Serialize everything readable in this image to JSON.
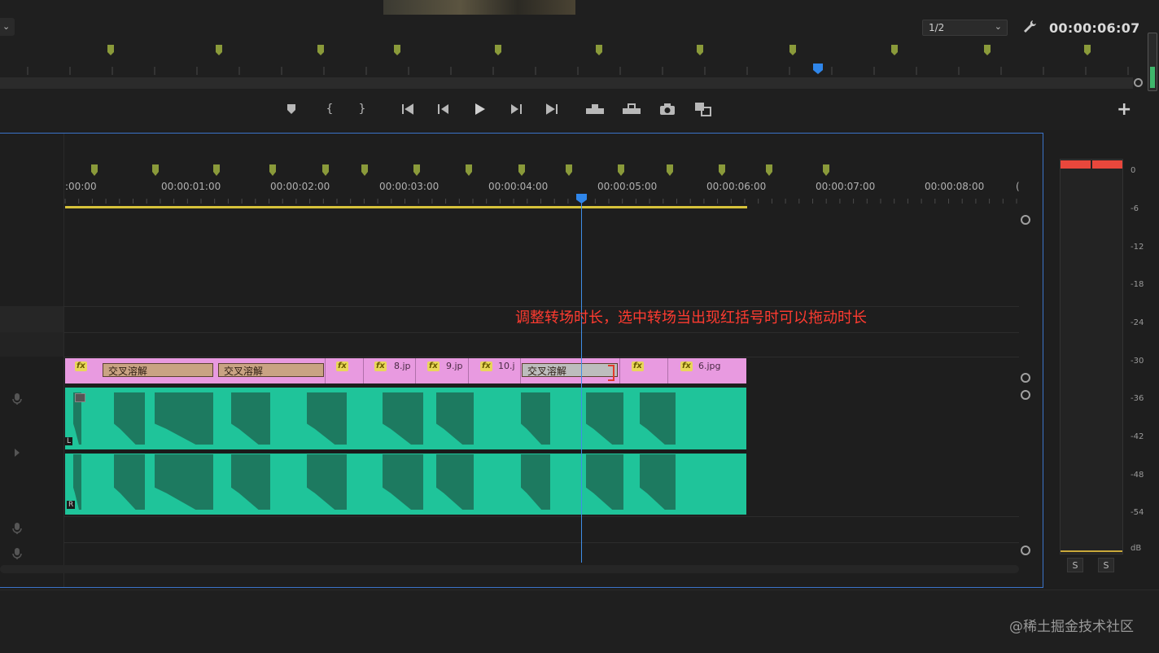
{
  "program_monitor": {
    "resolution": "1/2",
    "timecode": "00:00:06:07"
  },
  "timeline": {
    "ruler_labels": [
      ":00:00",
      "00:00:01:00",
      "00:00:02:00",
      "00:00:03:00",
      "00:00:04:00",
      "00:00:05:00",
      "00:00:06:00",
      "00:00:07:00",
      "00:00:08:00",
      "("
    ],
    "video_clips": [
      {
        "name": "8.jp"
      },
      {
        "name": "9.jp"
      },
      {
        "name": "10.j"
      },
      {
        "name": "6.jpg"
      }
    ],
    "transitions": [
      "交叉溶解",
      "交叉溶解",
      "交叉溶解"
    ],
    "fx_badge": "fx",
    "audio_labels": {
      "left": "L",
      "right": "R"
    }
  },
  "annotation": "调整转场时长，选中转场当出现红括号时可以拖动时长",
  "meter": {
    "db_labels": [
      "0",
      "-6",
      "-12",
      "-18",
      "-24",
      "-30",
      "-36",
      "-42",
      "-48",
      "-54",
      "dB"
    ],
    "solo_left": "S",
    "solo_right": "S"
  },
  "buttons": {
    "add": "+"
  },
  "watermark": "@稀土掘金技术社区",
  "colors": {
    "accent": "#3b74c9",
    "video_clip": "#e89ae0",
    "audio_clip": "#1fc49a",
    "annotation": "#ff3b30",
    "marker": "#8a9a3a",
    "peak": "#e8473c"
  }
}
